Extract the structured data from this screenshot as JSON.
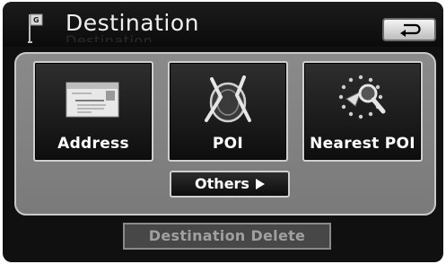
{
  "header": {
    "title": "Destination",
    "title_ghost": "Destination"
  },
  "menu": {
    "tiles": [
      {
        "label": "Address",
        "icon": "address-card-icon"
      },
      {
        "label": "POI",
        "icon": "plate-cutlery-icon"
      },
      {
        "label": "Nearest POI",
        "icon": "nearest-poi-icon"
      }
    ],
    "others_label": "Others"
  },
  "footer": {
    "delete_label": "Destination Delete"
  },
  "colors": {
    "background": "#101010",
    "panel": "#808080",
    "button_text": "#ffffff",
    "disabled_text": "#a0a0a0"
  }
}
